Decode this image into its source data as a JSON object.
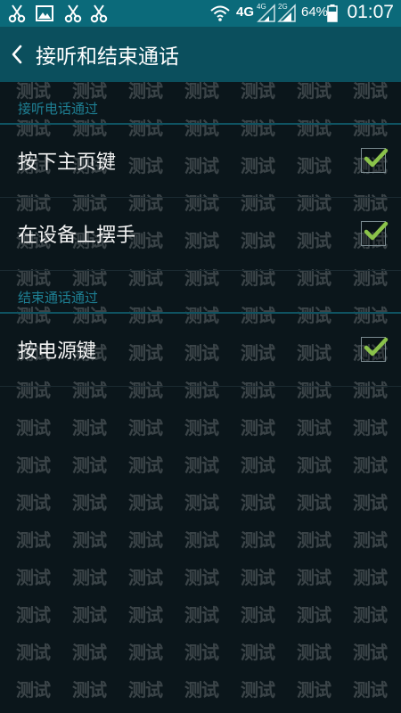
{
  "status_bar": {
    "notification_icons": [
      "scissors-icon",
      "image-icon",
      "scissors-icon",
      "scissors-icon"
    ],
    "network_label_main": "4G",
    "network_label_sim1": "4G",
    "network_label_sim2": "2G",
    "battery_percent": "64%",
    "time": "01:07"
  },
  "action_bar": {
    "title": "接听和结束通话"
  },
  "sections": [
    {
      "header": "接听电话通过",
      "items": [
        {
          "label": "按下主页键",
          "checked": true
        },
        {
          "label": "在设备上摆手",
          "checked": true
        }
      ]
    },
    {
      "header": "结束通话通过",
      "items": [
        {
          "label": "按电源键",
          "checked": true
        }
      ]
    }
  ],
  "watermark_text": "测试",
  "colors": {
    "status_bar_bg": "#0b6a7a",
    "action_bar_bg": "#0b4f5d",
    "section_header_text": "#1e7f93",
    "check_green": "#8bc34a"
  }
}
